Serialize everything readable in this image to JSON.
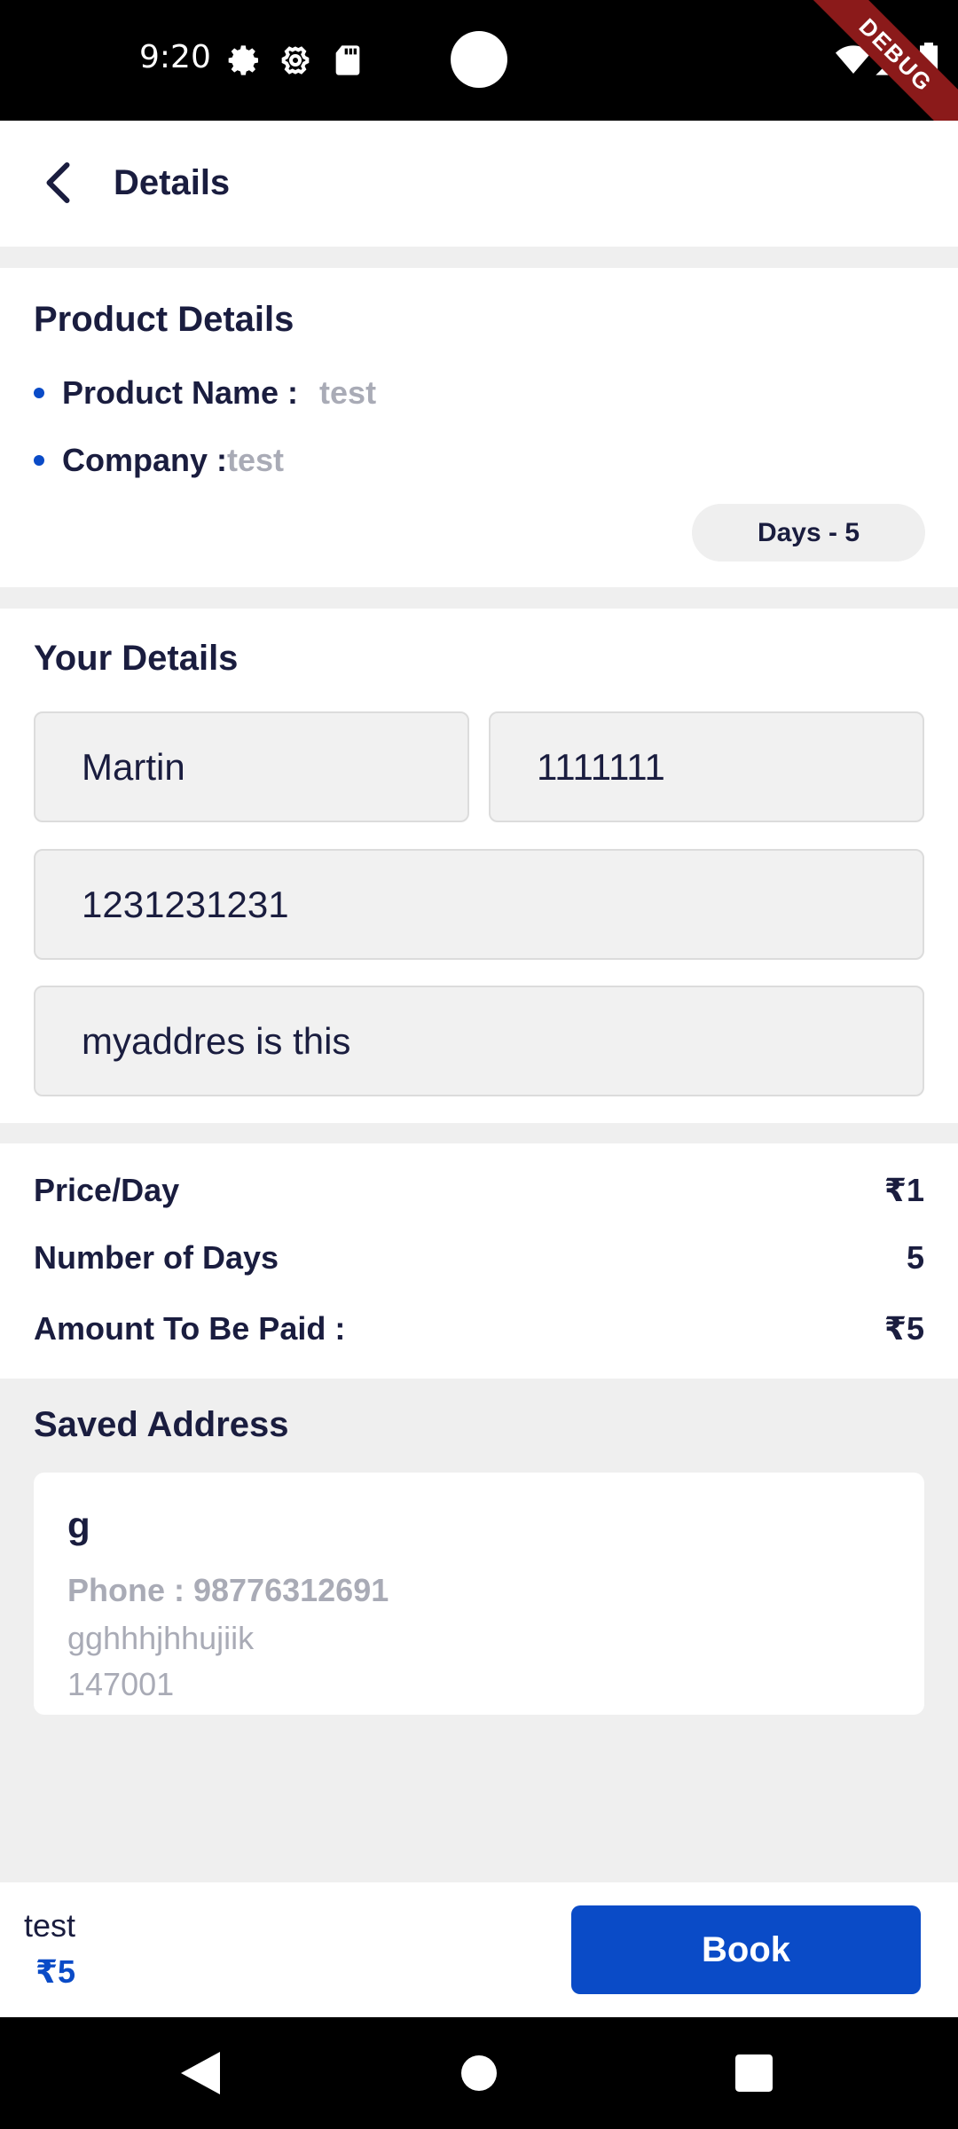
{
  "status_bar": {
    "time": "9:20",
    "icons": [
      "settings-icon",
      "gear-icon",
      "sd-card-icon",
      "wifi-icon",
      "signal-icon",
      "battery-icon"
    ],
    "debug_label": "DEBUG"
  },
  "app_bar": {
    "back_icon": "chevron-left-icon",
    "title": "Details"
  },
  "product_details": {
    "title": "Product Details",
    "product_name_label": "Product Name :",
    "product_name_value": "test",
    "company_label": "Company :",
    "company_value": "test",
    "days_badge": "Days - 5"
  },
  "your_details": {
    "title": "Your Details",
    "name": "Martin",
    "code": "1111111",
    "phone": "1231231231",
    "address": "myaddres is this"
  },
  "pricing": {
    "price_per_day_label": "Price/Day",
    "price_per_day_value": "₹1",
    "days_label": "Number of Days",
    "days_value": "5",
    "amount_label": "Amount To Be Paid :",
    "amount_value": "₹5"
  },
  "saved_address": {
    "title": "Saved Address",
    "name": "g",
    "phone": "Phone : 98776312691",
    "line1": "gghhhjhhujiik",
    "line2": "147001"
  },
  "bottom_bar": {
    "product_name": "test",
    "price": "₹5",
    "book_label": "Book"
  },
  "colors": {
    "accent": "#0a4bc7",
    "text": "#1a1d3f",
    "muted": "#a9abb6",
    "background": "#efefef"
  }
}
